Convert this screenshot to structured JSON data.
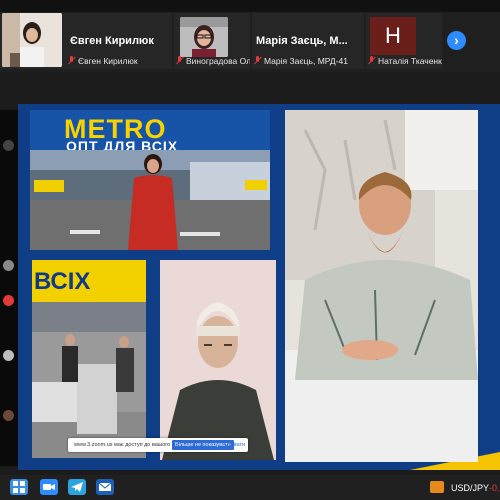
{
  "participants": [
    {
      "id": "p1",
      "display_name": "Євген Кирилюк",
      "sub_label": "Євген Кирилюк",
      "muted": true
    },
    {
      "id": "p2",
      "display_name": "Марія Заєць, М...",
      "sub_label": "Виноградова Олена В...",
      "muted": true
    },
    {
      "id": "p3",
      "display_name": "",
      "sub_label": "Марія Заєць, МРД-41",
      "muted": true
    },
    {
      "id": "p4",
      "display_name": "",
      "avatar_letter": "H",
      "sub_label": "Наталія Ткаченко",
      "muted": true
    }
  ],
  "next_button_icon": "chevron-right-icon",
  "slide": {
    "metro_sign": {
      "brand": "METRO",
      "slogan": "ОПТ ДЛЯ ВСІХ"
    },
    "store_sign": {
      "text": "ВСІХ"
    },
    "cookie_notice": {
      "text": "www.3.zoom.us має доступ до вашого екрана",
      "allow_label": "Більше не показувати",
      "close_label": "Сховати"
    }
  },
  "taskbar": {
    "icons": [
      "windows-icon",
      "zoom-icon",
      "telegram-icon",
      "mail-icon"
    ],
    "ticker_symbol": "USD/JPY",
    "ticker_change": "-0.0"
  },
  "colors": {
    "slide_bg": "#0f3d86",
    "accent_yellow": "#f5c400",
    "zoom_blue": "#2d8cff",
    "muted_red": "#e03a3a"
  }
}
